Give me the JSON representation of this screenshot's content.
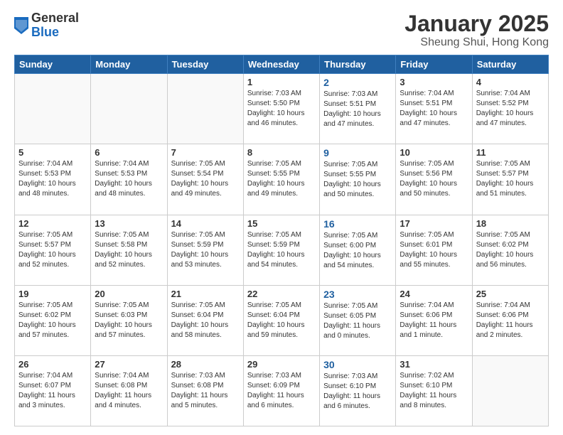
{
  "logo": {
    "general": "General",
    "blue": "Blue"
  },
  "title": {
    "month_year": "January 2025",
    "location": "Sheung Shui, Hong Kong"
  },
  "days_of_week": [
    "Sunday",
    "Monday",
    "Tuesday",
    "Wednesday",
    "Thursday",
    "Friday",
    "Saturday"
  ],
  "weeks": [
    [
      {
        "day": "",
        "info": ""
      },
      {
        "day": "",
        "info": ""
      },
      {
        "day": "",
        "info": ""
      },
      {
        "day": "1",
        "info": "Sunrise: 7:03 AM\nSunset: 5:50 PM\nDaylight: 10 hours\nand 46 minutes."
      },
      {
        "day": "2",
        "info": "Sunrise: 7:03 AM\nSunset: 5:51 PM\nDaylight: 10 hours\nand 47 minutes."
      },
      {
        "day": "3",
        "info": "Sunrise: 7:04 AM\nSunset: 5:51 PM\nDaylight: 10 hours\nand 47 minutes."
      },
      {
        "day": "4",
        "info": "Sunrise: 7:04 AM\nSunset: 5:52 PM\nDaylight: 10 hours\nand 47 minutes."
      }
    ],
    [
      {
        "day": "5",
        "info": "Sunrise: 7:04 AM\nSunset: 5:53 PM\nDaylight: 10 hours\nand 48 minutes."
      },
      {
        "day": "6",
        "info": "Sunrise: 7:04 AM\nSunset: 5:53 PM\nDaylight: 10 hours\nand 48 minutes."
      },
      {
        "day": "7",
        "info": "Sunrise: 7:05 AM\nSunset: 5:54 PM\nDaylight: 10 hours\nand 49 minutes."
      },
      {
        "day": "8",
        "info": "Sunrise: 7:05 AM\nSunset: 5:55 PM\nDaylight: 10 hours\nand 49 minutes."
      },
      {
        "day": "9",
        "info": "Sunrise: 7:05 AM\nSunset: 5:55 PM\nDaylight: 10 hours\nand 50 minutes."
      },
      {
        "day": "10",
        "info": "Sunrise: 7:05 AM\nSunset: 5:56 PM\nDaylight: 10 hours\nand 50 minutes."
      },
      {
        "day": "11",
        "info": "Sunrise: 7:05 AM\nSunset: 5:57 PM\nDaylight: 10 hours\nand 51 minutes."
      }
    ],
    [
      {
        "day": "12",
        "info": "Sunrise: 7:05 AM\nSunset: 5:57 PM\nDaylight: 10 hours\nand 52 minutes."
      },
      {
        "day": "13",
        "info": "Sunrise: 7:05 AM\nSunset: 5:58 PM\nDaylight: 10 hours\nand 52 minutes."
      },
      {
        "day": "14",
        "info": "Sunrise: 7:05 AM\nSunset: 5:59 PM\nDaylight: 10 hours\nand 53 minutes."
      },
      {
        "day": "15",
        "info": "Sunrise: 7:05 AM\nSunset: 5:59 PM\nDaylight: 10 hours\nand 54 minutes."
      },
      {
        "day": "16",
        "info": "Sunrise: 7:05 AM\nSunset: 6:00 PM\nDaylight: 10 hours\nand 54 minutes."
      },
      {
        "day": "17",
        "info": "Sunrise: 7:05 AM\nSunset: 6:01 PM\nDaylight: 10 hours\nand 55 minutes."
      },
      {
        "day": "18",
        "info": "Sunrise: 7:05 AM\nSunset: 6:02 PM\nDaylight: 10 hours\nand 56 minutes."
      }
    ],
    [
      {
        "day": "19",
        "info": "Sunrise: 7:05 AM\nSunset: 6:02 PM\nDaylight: 10 hours\nand 57 minutes."
      },
      {
        "day": "20",
        "info": "Sunrise: 7:05 AM\nSunset: 6:03 PM\nDaylight: 10 hours\nand 57 minutes."
      },
      {
        "day": "21",
        "info": "Sunrise: 7:05 AM\nSunset: 6:04 PM\nDaylight: 10 hours\nand 58 minutes."
      },
      {
        "day": "22",
        "info": "Sunrise: 7:05 AM\nSunset: 6:04 PM\nDaylight: 10 hours\nand 59 minutes."
      },
      {
        "day": "23",
        "info": "Sunrise: 7:05 AM\nSunset: 6:05 PM\nDaylight: 11 hours\nand 0 minutes."
      },
      {
        "day": "24",
        "info": "Sunrise: 7:04 AM\nSunset: 6:06 PM\nDaylight: 11 hours\nand 1 minute."
      },
      {
        "day": "25",
        "info": "Sunrise: 7:04 AM\nSunset: 6:06 PM\nDaylight: 11 hours\nand 2 minutes."
      }
    ],
    [
      {
        "day": "26",
        "info": "Sunrise: 7:04 AM\nSunset: 6:07 PM\nDaylight: 11 hours\nand 3 minutes."
      },
      {
        "day": "27",
        "info": "Sunrise: 7:04 AM\nSunset: 6:08 PM\nDaylight: 11 hours\nand 4 minutes."
      },
      {
        "day": "28",
        "info": "Sunrise: 7:03 AM\nSunset: 6:08 PM\nDaylight: 11 hours\nand 5 minutes."
      },
      {
        "day": "29",
        "info": "Sunrise: 7:03 AM\nSunset: 6:09 PM\nDaylight: 11 hours\nand 6 minutes."
      },
      {
        "day": "30",
        "info": "Sunrise: 7:03 AM\nSunset: 6:10 PM\nDaylight: 11 hours\nand 6 minutes."
      },
      {
        "day": "31",
        "info": "Sunrise: 7:02 AM\nSunset: 6:10 PM\nDaylight: 11 hours\nand 8 minutes."
      },
      {
        "day": "",
        "info": ""
      }
    ]
  ]
}
